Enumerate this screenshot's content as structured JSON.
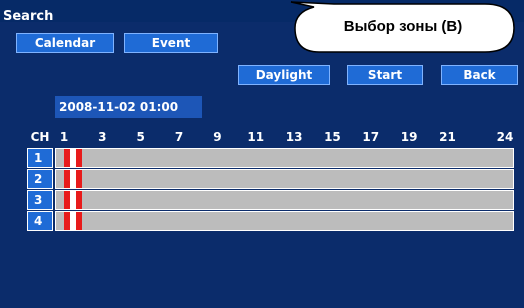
{
  "title": "Search",
  "tabs": [
    {
      "label": "Calendar"
    },
    {
      "label": "Event"
    }
  ],
  "callout": {
    "text": "Выбор зоны (B)"
  },
  "actions": {
    "daylight": "Daylight",
    "start": "Start",
    "back": "Back"
  },
  "datetime": "2008-11-02 01:00",
  "timeline": {
    "ch_header": "CH",
    "hour_labels": [
      "1",
      "3",
      "5",
      "7",
      "9",
      "11",
      "13",
      "15",
      "17",
      "19",
      "21",
      "24"
    ],
    "channels": [
      {
        "label": "1"
      },
      {
        "label": "2"
      },
      {
        "label": "3"
      },
      {
        "label": "4"
      }
    ],
    "recording_hour": 1,
    "colors": {
      "track": "#bcbcbc",
      "recording": "#e81b1b"
    }
  }
}
